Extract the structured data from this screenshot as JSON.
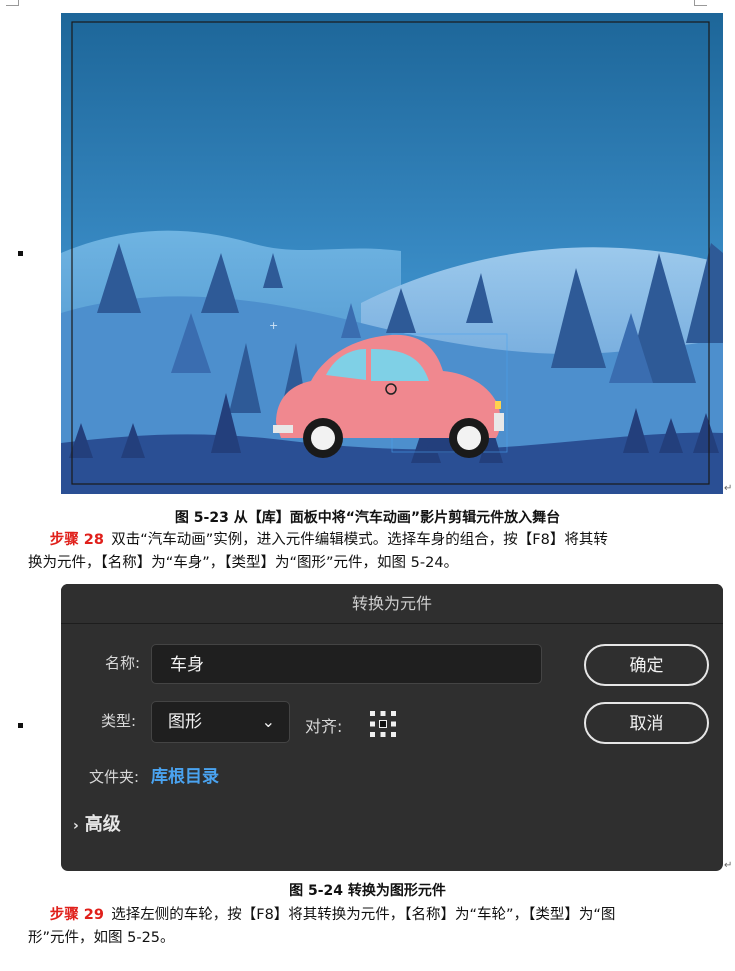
{
  "figure1": {
    "caption": "图 5-23  从【库】面板中将“汽车动画”影片剪辑元件放入舞台",
    "colors": {
      "sky_top": "#1f6a9e",
      "sky_bottom": "#4a9bd0",
      "car": "#f0888f",
      "ground": "#2a4f94"
    }
  },
  "step28": {
    "label": "步骤 28",
    "line1": "双击“汽车动画”实例，进入元件编辑模式。选择车身的组合，按【F8】将其转",
    "line2": "换为元件，【名称】为“车身”，【类型】为“图形”元件，如图 5-24。"
  },
  "dialog": {
    "title": "转换为元件",
    "name_label": "名称:",
    "name_value": "车身",
    "type_label": "类型:",
    "type_value": "图形",
    "align_label": "对齐:",
    "folder_label": "文件夹:",
    "folder_value": "库根目录",
    "advanced_label": "高级",
    "ok_label": "确定",
    "cancel_label": "取消",
    "colors": {
      "bg": "#2f2f2f",
      "link": "#4aa3f0"
    }
  },
  "figure2": {
    "caption": "图 5-24  转换为图形元件"
  },
  "step29": {
    "label": "步骤 29",
    "line1": "选择左侧的车轮，按【F8】将其转换为元件，【名称】为“车轮”，【类型】为“图",
    "line2": "形”元件，如图 5-25。"
  }
}
